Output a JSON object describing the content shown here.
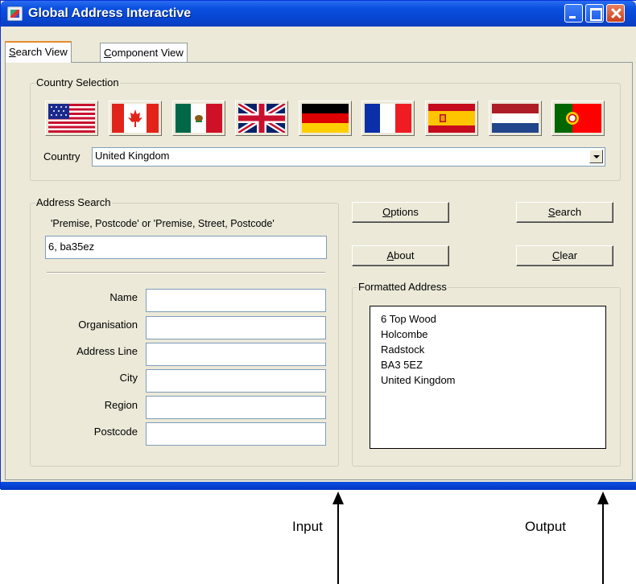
{
  "window": {
    "title": "Global Address Interactive"
  },
  "tabs": [
    {
      "label_prefix": "",
      "label_underlined": "S",
      "label_rest": "earch View"
    },
    {
      "label_prefix": "",
      "label_underlined": "C",
      "label_rest": "omponent View"
    }
  ],
  "country_selection": {
    "legend": "Country Selection",
    "flags": [
      "United States",
      "Canada",
      "Mexico",
      "United Kingdom",
      "Germany",
      "France",
      "Spain",
      "Netherlands",
      "Portugal"
    ],
    "country_label": "Country",
    "country_value": "United Kingdom"
  },
  "address_search": {
    "legend": "Address Search",
    "hint": "'Premise, Postcode' or 'Premise, Street, Postcode'",
    "query_value": "6, ba35ez",
    "fields": [
      {
        "label": "Name",
        "value": ""
      },
      {
        "label": "Organisation",
        "value": ""
      },
      {
        "label": "Address Line",
        "value": ""
      },
      {
        "label": "City",
        "value": ""
      },
      {
        "label": "Region",
        "value": ""
      },
      {
        "label": "Postcode",
        "value": ""
      }
    ]
  },
  "buttons": {
    "options": {
      "u": "O",
      "rest": "ptions"
    },
    "search": {
      "u": "S",
      "rest": "earch"
    },
    "about": {
      "u": "A",
      "rest": "bout"
    },
    "clear": {
      "u": "C",
      "rest": "lear"
    }
  },
  "formatted_address": {
    "legend": "Formatted Address",
    "lines": [
      "6 Top Wood",
      "Holcombe",
      "Radstock",
      "BA3 5EZ",
      "United Kingdom"
    ]
  },
  "annotations": {
    "input": "Input",
    "output": "Output"
  }
}
